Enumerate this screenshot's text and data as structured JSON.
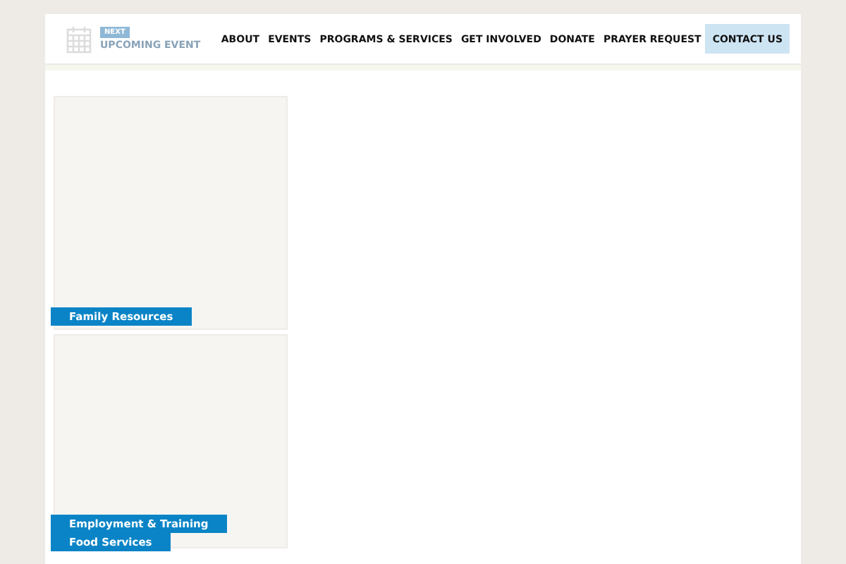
{
  "event": {
    "badge": "NEXT",
    "label": "UPCOMING EVENT"
  },
  "nav": [
    {
      "label": "ABOUT",
      "selected": false
    },
    {
      "label": "EVENTS",
      "selected": false
    },
    {
      "label": "PROGRAMS & SERVICES",
      "selected": false
    },
    {
      "label": "GET INVOLVED",
      "selected": false
    },
    {
      "label": "DONATE",
      "selected": false
    },
    {
      "label": "PRAYER REQUEST",
      "selected": false
    },
    {
      "label": "CONTACT US",
      "selected": true
    }
  ],
  "cards": [
    {
      "labels": [
        "Family Resources"
      ]
    },
    {
      "labels": [
        "Employment & Training",
        "Food Services"
      ]
    }
  ]
}
